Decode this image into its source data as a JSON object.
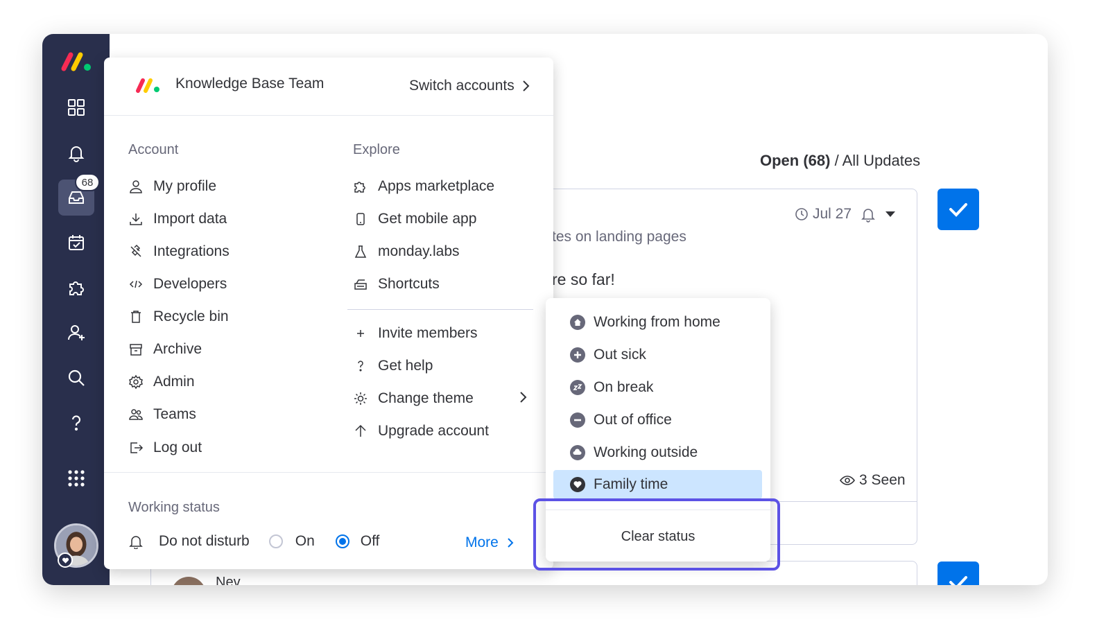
{
  "colors": {
    "rail_bg": "#292f4c",
    "accent": "#0073ea",
    "selected_bg": "#cce5ff",
    "highlight": "#5c52e5"
  },
  "rail": {
    "icons": [
      "monday-logo-icon",
      "grid-icon",
      "bell-icon",
      "inbox-icon",
      "calendar-check-icon",
      "puzzle-icon",
      "add-user-icon",
      "search-icon",
      "help-icon",
      "apps-grid-icon"
    ],
    "inbox_badge": "68"
  },
  "background": {
    "header_open": "Open (68)",
    "header_rest": " / All Updates",
    "post_date": "Jul 27",
    "post_title_fragment": "tes on landing pages",
    "post_body_fragment": "re so far!",
    "seen": "3 Seen",
    "next_post_name": "Nev"
  },
  "account_menu": {
    "team_name": "Knowledge Base Team",
    "switch_accounts": "Switch accounts",
    "account_title": "Account",
    "account_items": [
      {
        "label": "My profile",
        "icon": "user-icon"
      },
      {
        "label": "Import data",
        "icon": "download-icon"
      },
      {
        "label": "Integrations",
        "icon": "integrations-icon"
      },
      {
        "label": "Developers",
        "icon": "code-icon"
      },
      {
        "label": "Recycle bin",
        "icon": "trash-icon"
      },
      {
        "label": "Archive",
        "icon": "archive-icon"
      },
      {
        "label": "Admin",
        "icon": "gear-icon"
      },
      {
        "label": "Teams",
        "icon": "team-icon"
      },
      {
        "label": "Log out",
        "icon": "logout-icon"
      }
    ],
    "explore_title": "Explore",
    "explore_items": [
      {
        "label": "Apps marketplace",
        "icon": "puzzle-icon"
      },
      {
        "label": "Get mobile app",
        "icon": "mobile-icon"
      },
      {
        "label": "monday.labs",
        "icon": "flask-icon"
      },
      {
        "label": "Shortcuts",
        "icon": "keyboard-icon"
      }
    ],
    "more_items": [
      {
        "label": "Invite members",
        "icon": "plus-icon"
      },
      {
        "label": "Get help",
        "icon": "question-icon"
      },
      {
        "label": "Change theme",
        "icon": "sun-icon"
      },
      {
        "label": "Upgrade account",
        "icon": "arrow-up-icon"
      }
    ],
    "working_status": {
      "title": "Working status",
      "dnd_label": "Do not disturb",
      "on_label": "On",
      "off_label": "Off",
      "selected": "Off",
      "more_label": "More"
    }
  },
  "status_menu": {
    "items": [
      {
        "label": "Working from home",
        "icon": "home-icon"
      },
      {
        "label": "Out sick",
        "icon": "plus-circle-icon"
      },
      {
        "label": "On break",
        "icon": "sleep-icon"
      },
      {
        "label": "Out of office",
        "icon": "minus-circle-icon"
      },
      {
        "label": "Working outside",
        "icon": "cloud-icon"
      },
      {
        "label": "Family time",
        "icon": "heart-icon"
      }
    ],
    "selected": "Family time",
    "clear_label": "Clear status"
  }
}
